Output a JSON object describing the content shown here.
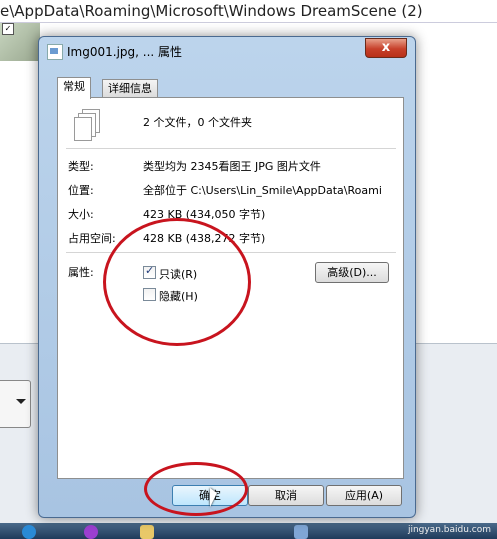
{
  "background": {
    "path_text": "e\\AppData\\Roaming\\Microsoft\\Windows DreamScene (2)"
  },
  "dialog": {
    "title": "Img001.jpg, ... 属性",
    "close_label": "x",
    "tabs": [
      {
        "label": "常规",
        "active": true
      },
      {
        "label": "详细信息",
        "active": false
      }
    ],
    "summary": "2 个文件，0 个文件夹",
    "rows": [
      {
        "label": "类型:",
        "value": "类型均为 2345看图王 JPG 图片文件"
      },
      {
        "label": "位置:",
        "value": "全部位于 C:\\Users\\Lin_Smile\\AppData\\Roami"
      },
      {
        "label": "大小:",
        "value": "423 KB (434,050 字节)"
      },
      {
        "label": "占用空间:",
        "value": "428 KB (438,272 字节)"
      }
    ],
    "attributes": {
      "label": "属性:",
      "readonly": {
        "label": "只读(R)",
        "checked": true
      },
      "hidden": {
        "label": "隐藏(H)",
        "checked": false
      },
      "advanced_label": "高级(D)..."
    },
    "buttons": {
      "ok": "确定",
      "cancel": "取消",
      "apply": "应用(A)"
    }
  },
  "watermark": "jingyan.baidu.com",
  "colors": {
    "annotation": "#c8141e",
    "close_button": "#c7402a",
    "dialog_frame": "#a8c4e2"
  }
}
